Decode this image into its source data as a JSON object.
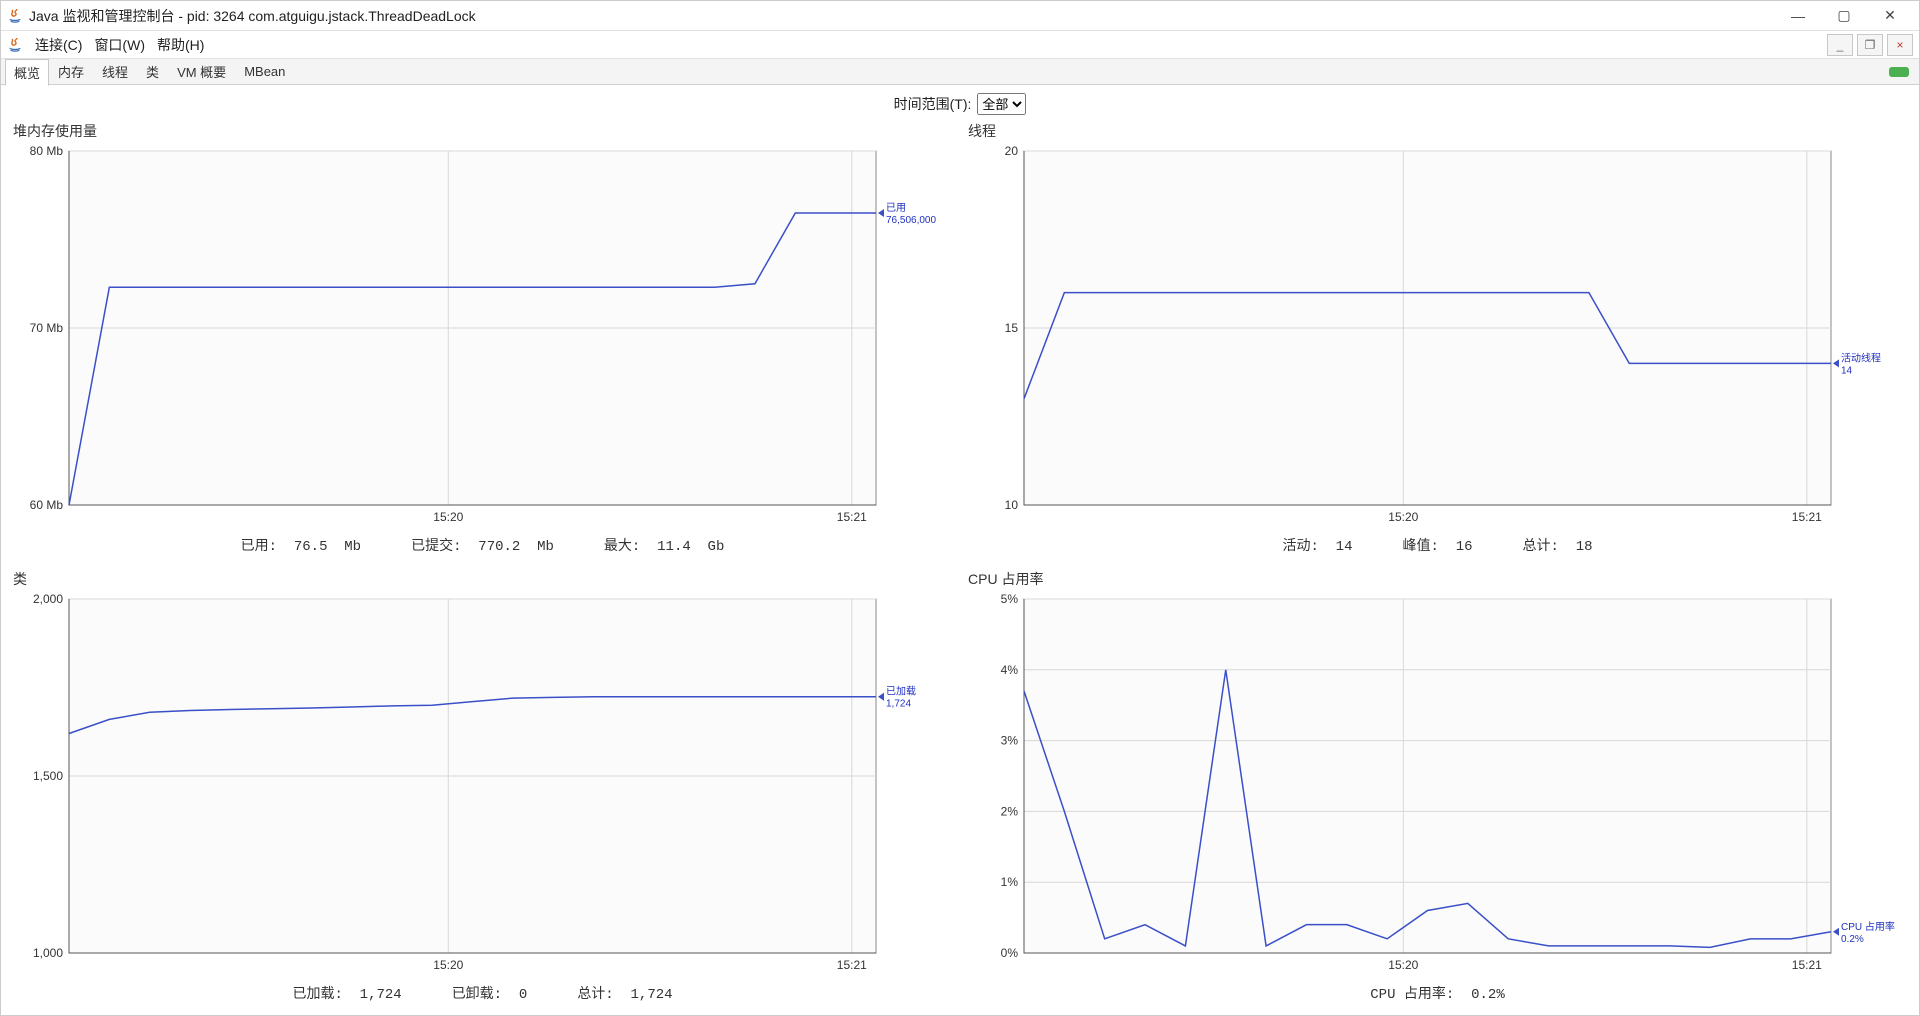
{
  "window": {
    "title": "Java 监视和管理控制台 - pid: 3264 com.atguigu.jstack.ThreadDeadLock"
  },
  "menubar": {
    "connection": "连接(C)",
    "window": "窗口(W)",
    "help": "帮助(H)"
  },
  "tabs": {
    "overview": "概览",
    "memory": "内存",
    "threads": "线程",
    "classes": "类",
    "vm": "VM 概要",
    "mbean": "MBean"
  },
  "range": {
    "label": "时间范围(T):",
    "selected": "全部"
  },
  "panels": {
    "heap": {
      "title": "堆内存使用量",
      "status_used_label": "已用:",
      "status_used_value": "76.5  Mb",
      "status_committed_label": "已提交:",
      "status_committed_value": "770.2  Mb",
      "status_max_label": "最大:",
      "status_max_value": "11.4  Gb",
      "legend_name": "已用",
      "legend_value": "76,506,000"
    },
    "threads": {
      "title": "线程",
      "status_live_label": "活动:",
      "status_live_value": "14",
      "status_peak_label": "峰值:",
      "status_peak_value": "16",
      "status_total_label": "总计:",
      "status_total_value": "18",
      "legend_name": "活动线程",
      "legend_value": "14"
    },
    "classes": {
      "title": "类",
      "status_loaded_label": "已加载:",
      "status_loaded_value": "1,724",
      "status_unloaded_label": "已卸载:",
      "status_unloaded_value": "0",
      "status_total_label": "总计:",
      "status_total_value": "1,724",
      "legend_name": "已加载",
      "legend_value": "1,724"
    },
    "cpu": {
      "title": "CPU 占用率",
      "status_label": "CPU 占用率:",
      "status_value": "0.2%",
      "legend_name": "CPU 占用率",
      "legend_value": "0.2%"
    }
  },
  "chart_data": [
    {
      "id": "heap",
      "type": "line",
      "title": "堆内存使用量",
      "xlabel": "",
      "ylabel": "",
      "y_unit": "Mb",
      "x_ticks": [
        "15:20",
        "15:21"
      ],
      "y_ticks": [
        60,
        70,
        80
      ],
      "ylim": [
        60,
        80
      ],
      "series": [
        {
          "name": "已用",
          "x": [
            0,
            1,
            2,
            3,
            4,
            5,
            6,
            7,
            8,
            9,
            10,
            11,
            12,
            13,
            14,
            15,
            16,
            17,
            18,
            19,
            20
          ],
          "y": [
            60.0,
            72.3,
            72.3,
            72.3,
            72.3,
            72.3,
            72.3,
            72.3,
            72.3,
            72.3,
            72.3,
            72.3,
            72.3,
            72.3,
            72.3,
            72.3,
            72.3,
            72.5,
            76.5,
            76.5,
            76.5
          ]
        }
      ]
    },
    {
      "id": "threads",
      "type": "line",
      "title": "线程",
      "xlabel": "",
      "ylabel": "",
      "x_ticks": [
        "15:20",
        "15:21"
      ],
      "y_ticks": [
        10,
        15,
        20
      ],
      "ylim": [
        10,
        20
      ],
      "series": [
        {
          "name": "活动线程",
          "x": [
            0,
            1,
            2,
            3,
            4,
            5,
            6,
            7,
            8,
            9,
            10,
            11,
            12,
            13,
            14,
            15,
            16,
            17,
            18,
            19,
            20
          ],
          "y": [
            13,
            16,
            16,
            16,
            16,
            16,
            16,
            16,
            16,
            16,
            16,
            16,
            16,
            16,
            16,
            14,
            14,
            14,
            14,
            14,
            14
          ]
        }
      ]
    },
    {
      "id": "classes",
      "type": "line",
      "title": "类",
      "xlabel": "",
      "ylabel": "",
      "x_ticks": [
        "15:20",
        "15:21"
      ],
      "y_ticks": [
        1000,
        1500,
        2000
      ],
      "ylim": [
        1000,
        2000
      ],
      "series": [
        {
          "name": "已加载",
          "x": [
            0,
            1,
            2,
            3,
            4,
            5,
            6,
            7,
            8,
            9,
            10,
            11,
            12,
            13,
            14,
            15,
            16,
            17,
            18,
            19,
            20
          ],
          "y": [
            1620,
            1660,
            1680,
            1685,
            1688,
            1690,
            1692,
            1695,
            1698,
            1700,
            1710,
            1720,
            1722,
            1724,
            1724,
            1724,
            1724,
            1724,
            1724,
            1724,
            1724
          ]
        }
      ]
    },
    {
      "id": "cpu",
      "type": "line",
      "title": "CPU 占用率",
      "xlabel": "",
      "ylabel": "",
      "y_unit": "%",
      "x_ticks": [
        "15:20",
        "15:21"
      ],
      "y_ticks": [
        0,
        1,
        2,
        3,
        4,
        5
      ],
      "ylim": [
        0,
        5
      ],
      "series": [
        {
          "name": "CPU 占用率",
          "x": [
            0,
            1,
            2,
            3,
            4,
            5,
            6,
            7,
            8,
            9,
            10,
            11,
            12,
            13,
            14,
            15,
            16,
            17,
            18,
            19,
            20
          ],
          "y": [
            3.7,
            2.0,
            0.2,
            0.4,
            0.1,
            4.0,
            0.1,
            0.4,
            0.4,
            0.2,
            0.6,
            0.7,
            0.2,
            0.1,
            0.1,
            0.1,
            0.1,
            0.08,
            0.2,
            0.2,
            0.3
          ]
        }
      ]
    }
  ]
}
